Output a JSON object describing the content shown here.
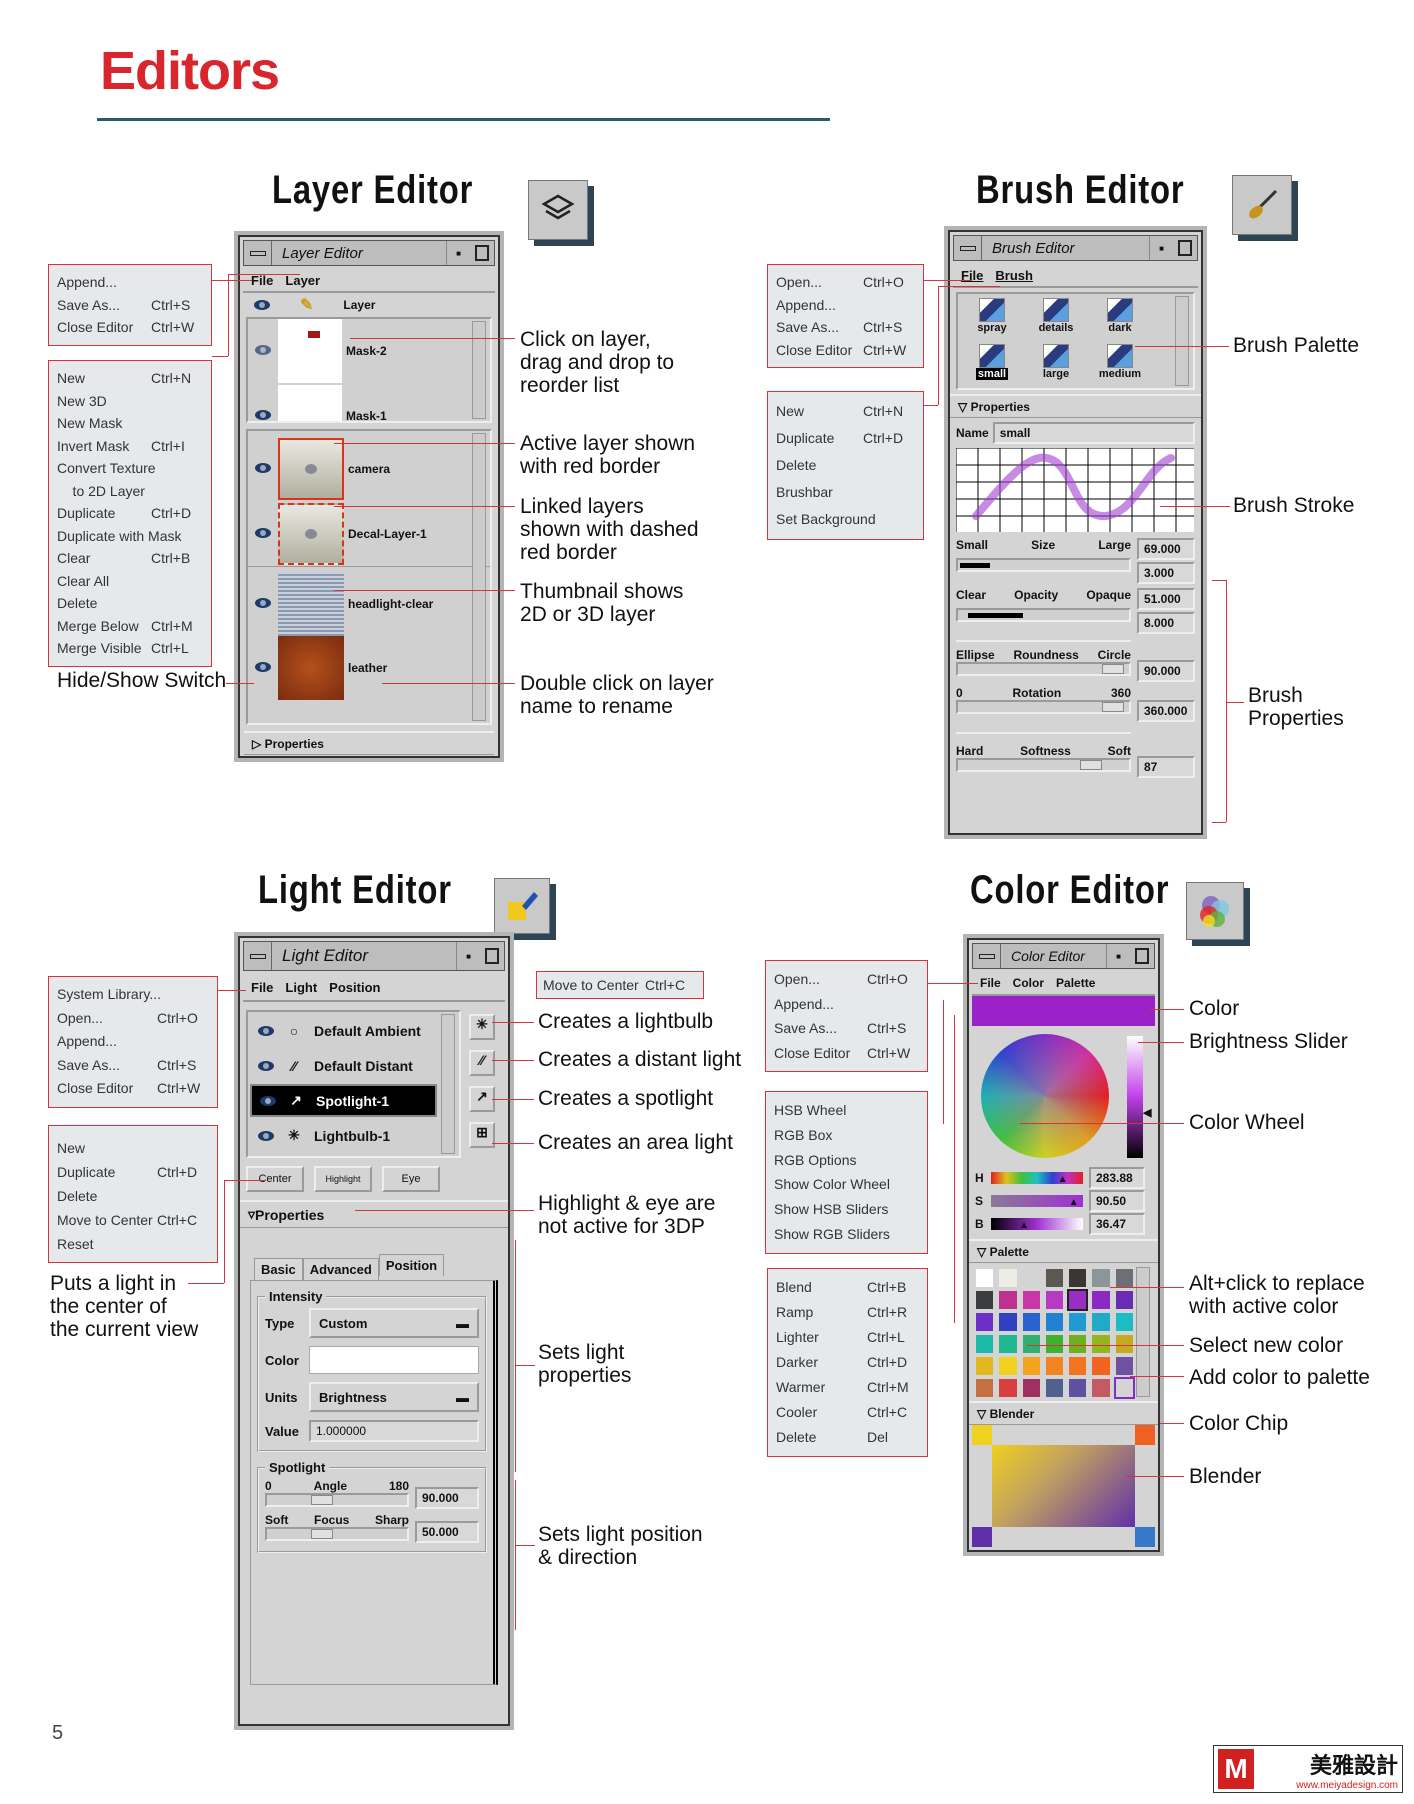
{
  "page": {
    "title": "Editors",
    "page_number": "5",
    "logo_text": "美雅設計",
    "logo_url_text": "www.meiyadesign.com"
  },
  "layer": {
    "heading": "Layer Editor",
    "icon": "layers-icon",
    "window_title": "Layer Editor",
    "menubar": [
      "File",
      "Layer"
    ],
    "header_label": "Layer",
    "masks": [
      {
        "name": "Mask-2",
        "hidden": true
      },
      {
        "name": "Mask-1",
        "hidden": false
      }
    ],
    "layers": [
      {
        "name": "camera",
        "state": "active"
      },
      {
        "name": "Decal-Layer-1",
        "state": "linked"
      },
      {
        "name": "headlight-clear",
        "state": "normal"
      },
      {
        "name": "leather",
        "state": "normal"
      }
    ],
    "properties_label": "Properties",
    "file_menu": [
      [
        "Append...",
        ""
      ],
      [
        "Save As...",
        "Ctrl+S"
      ],
      [
        "Close Editor",
        "Ctrl+W"
      ]
    ],
    "layer_menu": [
      [
        "New",
        "Ctrl+N"
      ],
      [
        "New 3D",
        ""
      ],
      [
        "New Mask",
        ""
      ],
      [
        "Invert Mask",
        "Ctrl+I"
      ],
      [
        "Convert Texture",
        ""
      ],
      [
        "    to 2D Layer",
        ""
      ],
      [
        "Duplicate",
        "Ctrl+D"
      ],
      [
        "Duplicate with Mask",
        ""
      ],
      [
        "Clear",
        "Ctrl+B"
      ],
      [
        "Clear All",
        ""
      ],
      [
        "Delete",
        ""
      ],
      [
        "Merge Below",
        "Ctrl+M"
      ],
      [
        "Merge Visible",
        "Ctrl+L"
      ]
    ],
    "callouts": {
      "hide_show": "Hide/Show Switch",
      "reorder": [
        "Click on layer,",
        "drag and drop to",
        "reorder list"
      ],
      "active": [
        "Active layer shown",
        "with red border"
      ],
      "linked": [
        "Linked layers",
        "shown with dashed",
        "red border"
      ],
      "thumb": [
        "Thumbnail shows",
        "2D or 3D layer"
      ],
      "rename": [
        "Double click on layer",
        "name to rename"
      ]
    }
  },
  "brush": {
    "heading": "Brush Editor",
    "icon": "brush-icon",
    "window_title": "Brush Editor",
    "menubar": [
      "File",
      "Brush"
    ],
    "palette": [
      {
        "name": "spray"
      },
      {
        "name": "details"
      },
      {
        "name": "dark"
      },
      {
        "name": "small",
        "selected": true
      },
      {
        "name": "large"
      },
      {
        "name": "medium"
      }
    ],
    "properties_label": "Properties",
    "name_label": "Name",
    "name_value": "small",
    "size": {
      "min": "Small",
      "label": "Size",
      "max": "Large",
      "value1": "69.000",
      "value2": "3.000"
    },
    "opacity": {
      "min": "Clear",
      "label": "Opacity",
      "max": "Opaque",
      "value1": "51.000",
      "value2": "8.000"
    },
    "roundness": {
      "min": "Ellipse",
      "label": "Roundness",
      "max": "Circle",
      "value": "90.000"
    },
    "rotation": {
      "min": "0",
      "label": "Rotation",
      "max": "360",
      "value": "360.000"
    },
    "softness": {
      "min": "Hard",
      "label": "Softness",
      "max": "Soft",
      "value": "87"
    },
    "stroke_color": "#a040d0",
    "file_menu": [
      [
        "Open...",
        "Ctrl+O"
      ],
      [
        "Append...",
        ""
      ],
      [
        "Save As...",
        "Ctrl+S"
      ],
      [
        "Close Editor",
        "Ctrl+W"
      ]
    ],
    "brush_menu": [
      [
        "New",
        "Ctrl+N"
      ],
      [
        "Duplicate",
        "Ctrl+D"
      ],
      [
        "Delete",
        ""
      ],
      [
        "Brushbar",
        ""
      ],
      [
        "Set Background",
        ""
      ]
    ],
    "callouts": {
      "palette": "Brush Palette",
      "stroke": "Brush Stroke",
      "props": [
        "Brush",
        "Properties"
      ]
    }
  },
  "light": {
    "heading": "Light Editor",
    "icon": "spotlight-icon",
    "window_title": "Light Editor",
    "menubar": [
      "File",
      "Light",
      "Position"
    ],
    "lights": [
      {
        "name": "Default Ambient",
        "icon": "ambient-icon"
      },
      {
        "name": "Default Distant",
        "icon": "distant-icon"
      },
      {
        "name": "Spotlight-1",
        "icon": "spotlight-icon",
        "selected": true
      },
      {
        "name": "Lightbulb-1",
        "icon": "lightbulb-icon"
      }
    ],
    "buttons": [
      "Center",
      "Highlight",
      "Eye"
    ],
    "properties_label": "Properties",
    "tabs": [
      "Basic",
      "Advanced",
      "Position"
    ],
    "intensity": {
      "label": "Intensity",
      "type_label": "Type",
      "type_value": "Custom",
      "color_label": "Color",
      "units_label": "Units",
      "units_value": "Brightness",
      "value_label": "Value",
      "value": "1.000000"
    },
    "spotlight": {
      "label": "Spotlight",
      "angle": {
        "min": "0",
        "label": "Angle",
        "max": "180",
        "value": "90.000"
      },
      "focus": {
        "min": "Soft",
        "label": "Focus",
        "max": "Sharp",
        "value": "50.000"
      }
    },
    "file_menu": [
      [
        "System Library...",
        ""
      ],
      [
        "Open...",
        "Ctrl+O"
      ],
      [
        "Append...",
        ""
      ],
      [
        "Save As...",
        "Ctrl+S"
      ],
      [
        "Close Editor",
        "Ctrl+W"
      ]
    ],
    "light_menu": [
      [
        "New",
        ""
      ],
      [
        "Duplicate",
        "Ctrl+D"
      ],
      [
        "Delete",
        ""
      ],
      [
        "Move to Center",
        "Ctrl+C"
      ],
      [
        "Reset",
        ""
      ]
    ],
    "position_menu": [
      [
        "Move to Center",
        "Ctrl+C"
      ]
    ],
    "callouts": {
      "bulb": "Creates a lightbulb",
      "distant": "Creates a distant light",
      "spot": "Creates a spotlight",
      "area": "Creates an area light",
      "highlight": [
        "Highlight & eye are",
        "not active for 3DP"
      ],
      "center": [
        "Puts a light in",
        "the center of",
        "the current view"
      ],
      "props": [
        "Sets light",
        "properties"
      ],
      "position": [
        "Sets light position",
        "& direction"
      ]
    }
  },
  "color": {
    "heading": "Color Editor",
    "icon": "color-wheel-icon",
    "window_title": "Color Editor",
    "menubar": [
      "File",
      "Color",
      "Palette"
    ],
    "active_color": "#9a22c8",
    "hsb": [
      {
        "label": "H",
        "value": "283.88"
      },
      {
        "label": "S",
        "value": "90.50"
      },
      {
        "label": "B",
        "value": "36.47"
      }
    ],
    "palette_label": "Palette",
    "blender_label": "Blender",
    "swatches": [
      [
        "#ffffff",
        "#efebe7",
        "#d4d4d4",
        "#5c5852",
        "#3a3634",
        "#8c9599",
        "#6c7074"
      ],
      [
        "#3b3d41",
        "#c0308e",
        "#c836a8",
        "#b63ac2",
        "#9a2ec4",
        "#8a2ac2",
        "#6a2cb2"
      ],
      [
        "#6c30c8",
        "#3040c0",
        "#2a62d0",
        "#2082d0",
        "#209ad2",
        "#20aac8",
        "#1cbcc4"
      ],
      [
        "#1cbaa8",
        "#20b890",
        "#30b070",
        "#40b030",
        "#70b020",
        "#94b420",
        "#c4aa20"
      ],
      [
        "#e2b820",
        "#f2d020",
        "#f2a420",
        "#f28420",
        "#f27420",
        "#f06420",
        "#7050a0"
      ],
      [
        "#c47040",
        "#d84040",
        "#a03060",
        "#506090",
        "#6050a0",
        "#c45a64",
        "#d4d4d4"
      ]
    ],
    "blender_corners": [
      "#f0d020",
      "#f06020",
      "#6030a8",
      "#3878c8"
    ],
    "file_menu": [
      [
        "Open...",
        "Ctrl+O"
      ],
      [
        "Append...",
        ""
      ],
      [
        "Save As...",
        "Ctrl+S"
      ],
      [
        "Close Editor",
        "Ctrl+W"
      ]
    ],
    "color_menu": [
      [
        "HSB Wheel",
        ""
      ],
      [
        "RGB Box",
        ""
      ],
      [
        "RGB Options",
        ""
      ],
      [
        "Show Color Wheel",
        ""
      ],
      [
        "Show HSB Sliders",
        ""
      ],
      [
        "Show RGB Sliders",
        ""
      ]
    ],
    "palette_menu": [
      [
        "Blend",
        "Ctrl+B"
      ],
      [
        "Ramp",
        "Ctrl+R"
      ],
      [
        "Lighter",
        "Ctrl+L"
      ],
      [
        "Darker",
        "Ctrl+D"
      ],
      [
        "Warmer",
        "Ctrl+M"
      ],
      [
        "Cooler",
        "Ctrl+C"
      ],
      [
        "Delete",
        "Del"
      ]
    ],
    "callouts": {
      "color": "Color",
      "brightness": "Brightness Slider",
      "wheel": "Color Wheel",
      "alt": [
        "Alt+click to replace",
        "with active color"
      ],
      "select": "Select new color",
      "add": "Add color to palette",
      "chip": "Color Chip",
      "blender": "Blender"
    }
  }
}
